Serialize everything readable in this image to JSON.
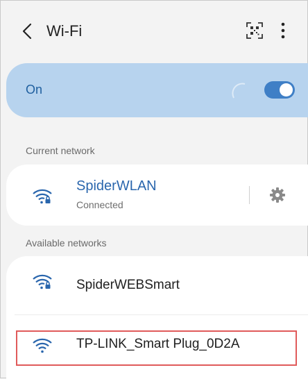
{
  "header": {
    "title": "Wi-Fi",
    "back_icon": "chevron-left-icon",
    "qr_icon": "qr-scan-icon",
    "more_icon": "more-vertical-icon"
  },
  "wifi_toggle": {
    "label": "On",
    "state": "on"
  },
  "current_section": {
    "label": "Current network",
    "network": {
      "name": "SpiderWLAN",
      "status": "Connected",
      "icon": "wifi-lock-icon",
      "settings_icon": "gear-icon"
    }
  },
  "available_section": {
    "label": "Available networks",
    "networks": [
      {
        "name": "SpiderWEBSmart",
        "icon": "wifi-lock-icon"
      },
      {
        "name": "TP-LINK_Smart Plug_0D2A",
        "icon": "wifi-icon"
      }
    ]
  },
  "colors": {
    "accent": "#3f7fc6",
    "on_card_bg": "#b7d3ee",
    "current_network_text": "#2a66ad",
    "highlight_border": "#e05a5a",
    "page_bg": "#f3f3f3"
  }
}
